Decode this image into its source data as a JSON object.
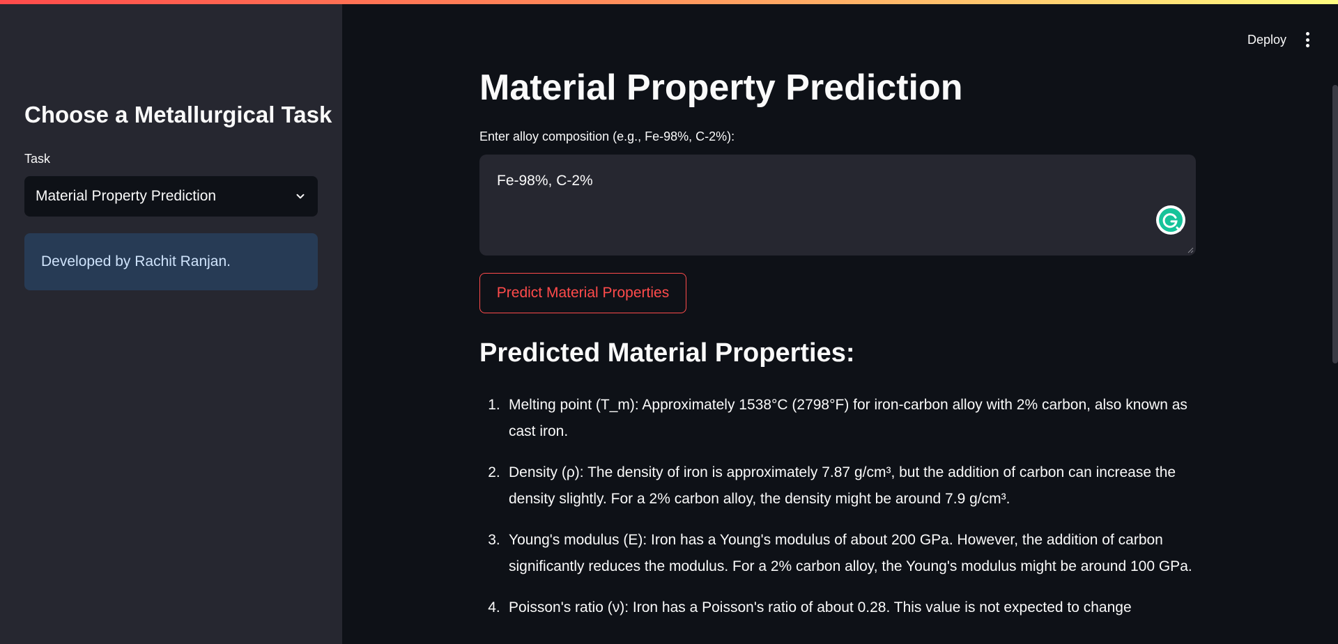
{
  "sidebar": {
    "title": "Choose a Metallurgical Task",
    "task_label": "Task",
    "task_selected": "Material Property Prediction",
    "info": "Developed by Rachit Ranjan."
  },
  "header": {
    "deploy_label": "Deploy"
  },
  "main": {
    "title": "Material Property Prediction",
    "input_label": "Enter alloy composition (e.g., Fe-98%, C-2%):",
    "input_value": "Fe-98%, C-2%",
    "predict_button": "Predict Material Properties",
    "results_heading": "Predicted Material Properties:",
    "results": [
      {
        "num": "1.",
        "text": "Melting point (T_m): Approximately 1538°C (2798°F) for iron-carbon alloy with 2% carbon, also known as cast iron."
      },
      {
        "num": "2.",
        "text": "Density (ρ): The density of iron is approximately 7.87 g/cm³, but the addition of carbon can increase the density slightly. For a 2% carbon alloy, the density might be around 7.9 g/cm³."
      },
      {
        "num": "3.",
        "text": "Young's modulus (E): Iron has a Young's modulus of about 200 GPa. However, the addition of carbon significantly reduces the modulus. For a 2% carbon alloy, the Young's modulus might be around 100 GPa."
      },
      {
        "num": "4.",
        "text": "Poisson's ratio (ν): Iron has a Poisson's ratio of about 0.28. This value is not expected to change"
      }
    ]
  },
  "colors": {
    "accent": "#ff4b4b",
    "background": "#0e1117",
    "sidebar": "#262730",
    "info_bg": "#273b55"
  },
  "icons": {
    "chevron": "chevron-down-icon",
    "menu": "vertical-dots-icon",
    "grammarly": "grammarly-icon"
  }
}
